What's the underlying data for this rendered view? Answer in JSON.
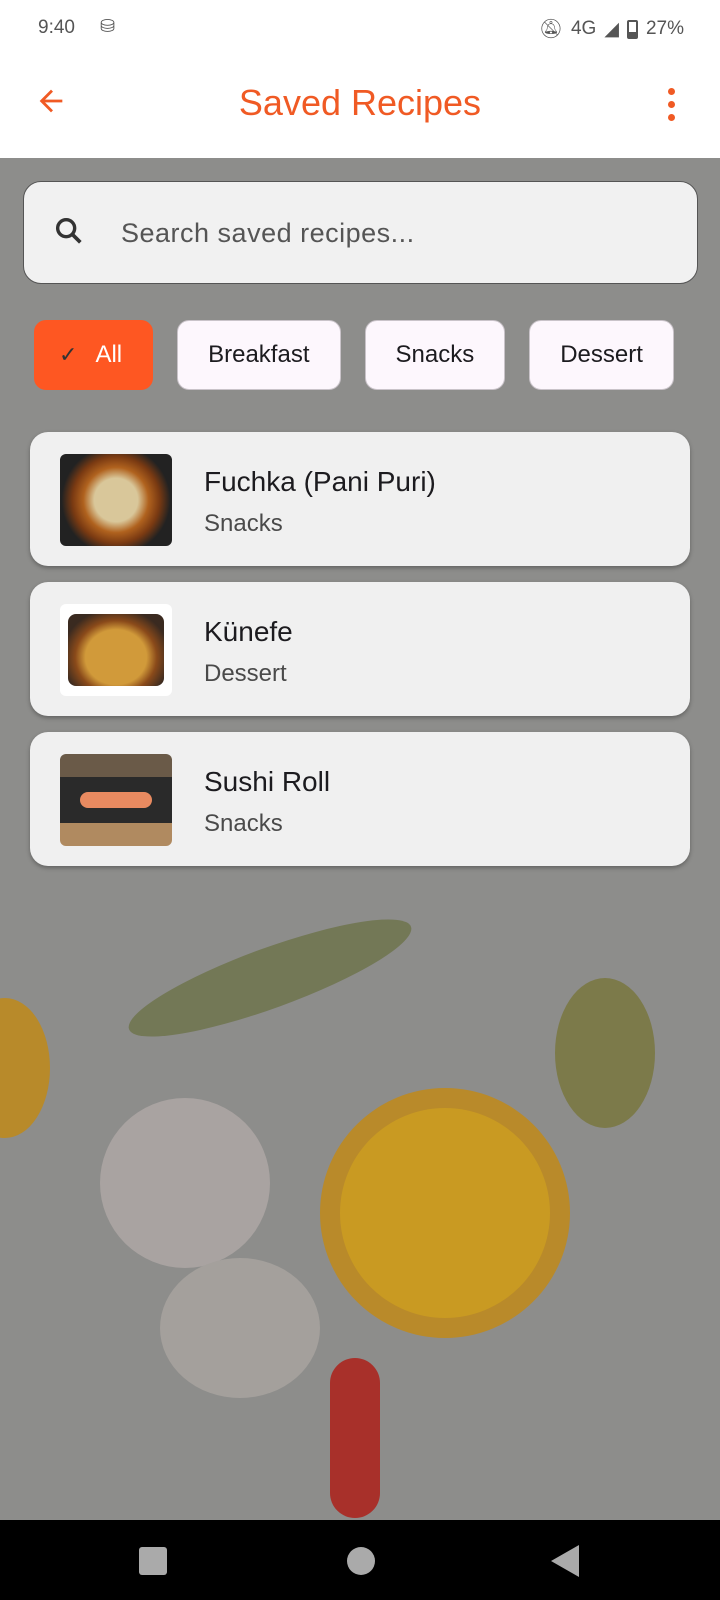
{
  "status_bar": {
    "time": "9:40",
    "network": "4G",
    "battery": "27%"
  },
  "app_bar": {
    "title": "Saved Recipes",
    "back_icon": "arrow-left-icon",
    "menu_icon": "more-vert-icon"
  },
  "search": {
    "placeholder": "Search saved recipes..."
  },
  "filters": [
    {
      "label": "All",
      "selected": true
    },
    {
      "label": "Breakfast",
      "selected": false
    },
    {
      "label": "Snacks",
      "selected": false
    },
    {
      "label": "Dessert",
      "selected": false
    }
  ],
  "recipes": [
    {
      "name": "Fuchka (Pani Puri)",
      "category": "Snacks"
    },
    {
      "name": "Künefe",
      "category": "Dessert"
    },
    {
      "name": "Sushi Roll",
      "category": "Snacks"
    }
  ],
  "colors": {
    "accent": "#f05a24",
    "chip_selected": "#fe5722"
  }
}
